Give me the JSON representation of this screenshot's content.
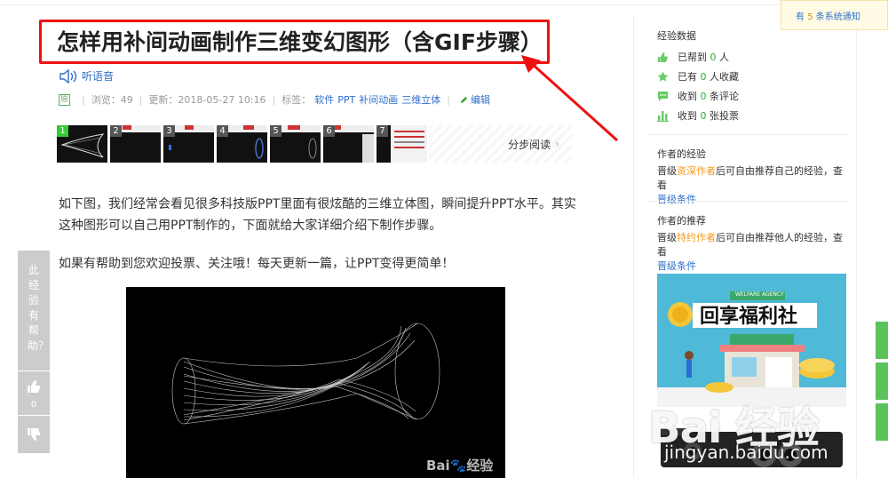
{
  "article": {
    "title": "怎样用补间动画制作三维变幻图形（含GIF步骤）",
    "listen_label": "听语音",
    "original_badge": "原",
    "views_label": "浏览：49",
    "updated_label": "更新：2018-05-27 10:16",
    "tags_label": "标签：",
    "tags": [
      "软件",
      "PPT",
      "补间动画",
      "三维立体"
    ],
    "edit_label": "编辑",
    "thumbnails": [
      "1",
      "2",
      "3",
      "4",
      "5",
      "6",
      "7"
    ],
    "steps_read_label": "分步阅读",
    "paragraph1": "如下图，我们经常会看见很多科技版PPT里面有很炫酷的三维立体图，瞬间提升PPT水平。其实这种图形可以自己用PPT制作的，下面就给大家详细介绍下制作步骤。",
    "paragraph2": "如果有帮助到您欢迎投票、关注哦！每天更新一篇，让PPT变得更简单！",
    "image_watermark": "Bai🐾经验"
  },
  "helpful_panel": {
    "question": "此经验有帮助？",
    "like_count": "0"
  },
  "sidebar": {
    "data_title": "经验数据",
    "stats": [
      {
        "prefix": "已帮到 ",
        "num": "0",
        "suffix": " 人",
        "icon": "thumbs-up-icon"
      },
      {
        "prefix": "已有 ",
        "num": "0",
        "suffix": " 人收藏",
        "icon": "star-icon"
      },
      {
        "prefix": "收到 ",
        "num": "0",
        "suffix": " 条评论",
        "icon": "comment-icon"
      },
      {
        "prefix": "收到 ",
        "num": "0",
        "suffix": " 张投票",
        "icon": "vote-icon"
      }
    ],
    "author_exp_title": "作者的经验",
    "author_exp_note_a": "晋级",
    "author_exp_note_hl": "资深作者",
    "author_exp_note_b": "后可自由推荐自己的经验，查看",
    "author_exp_link": "晋级条件",
    "author_rec_title": "作者的推荐",
    "author_rec_note_a": "晋级",
    "author_rec_note_hl": "特约作者",
    "author_rec_note_b": "后可自由推荐他人的经验，查看",
    "author_rec_link": "晋级条件",
    "banner_text": "回享福利社",
    "banner_small": "WELFARE AGENCY"
  },
  "notice": {
    "prefix": "有 ",
    "num": "5",
    "suffix": " 条系统通知"
  },
  "watermark": {
    "logo": "Bai 经验",
    "url": "jingyan.baidu.com"
  },
  "colors": {
    "accent_blue": "#2f6fc9",
    "highlight_red": "#e11111",
    "stat_green": "#33aa33",
    "rank_orange": "#f59a1a"
  }
}
